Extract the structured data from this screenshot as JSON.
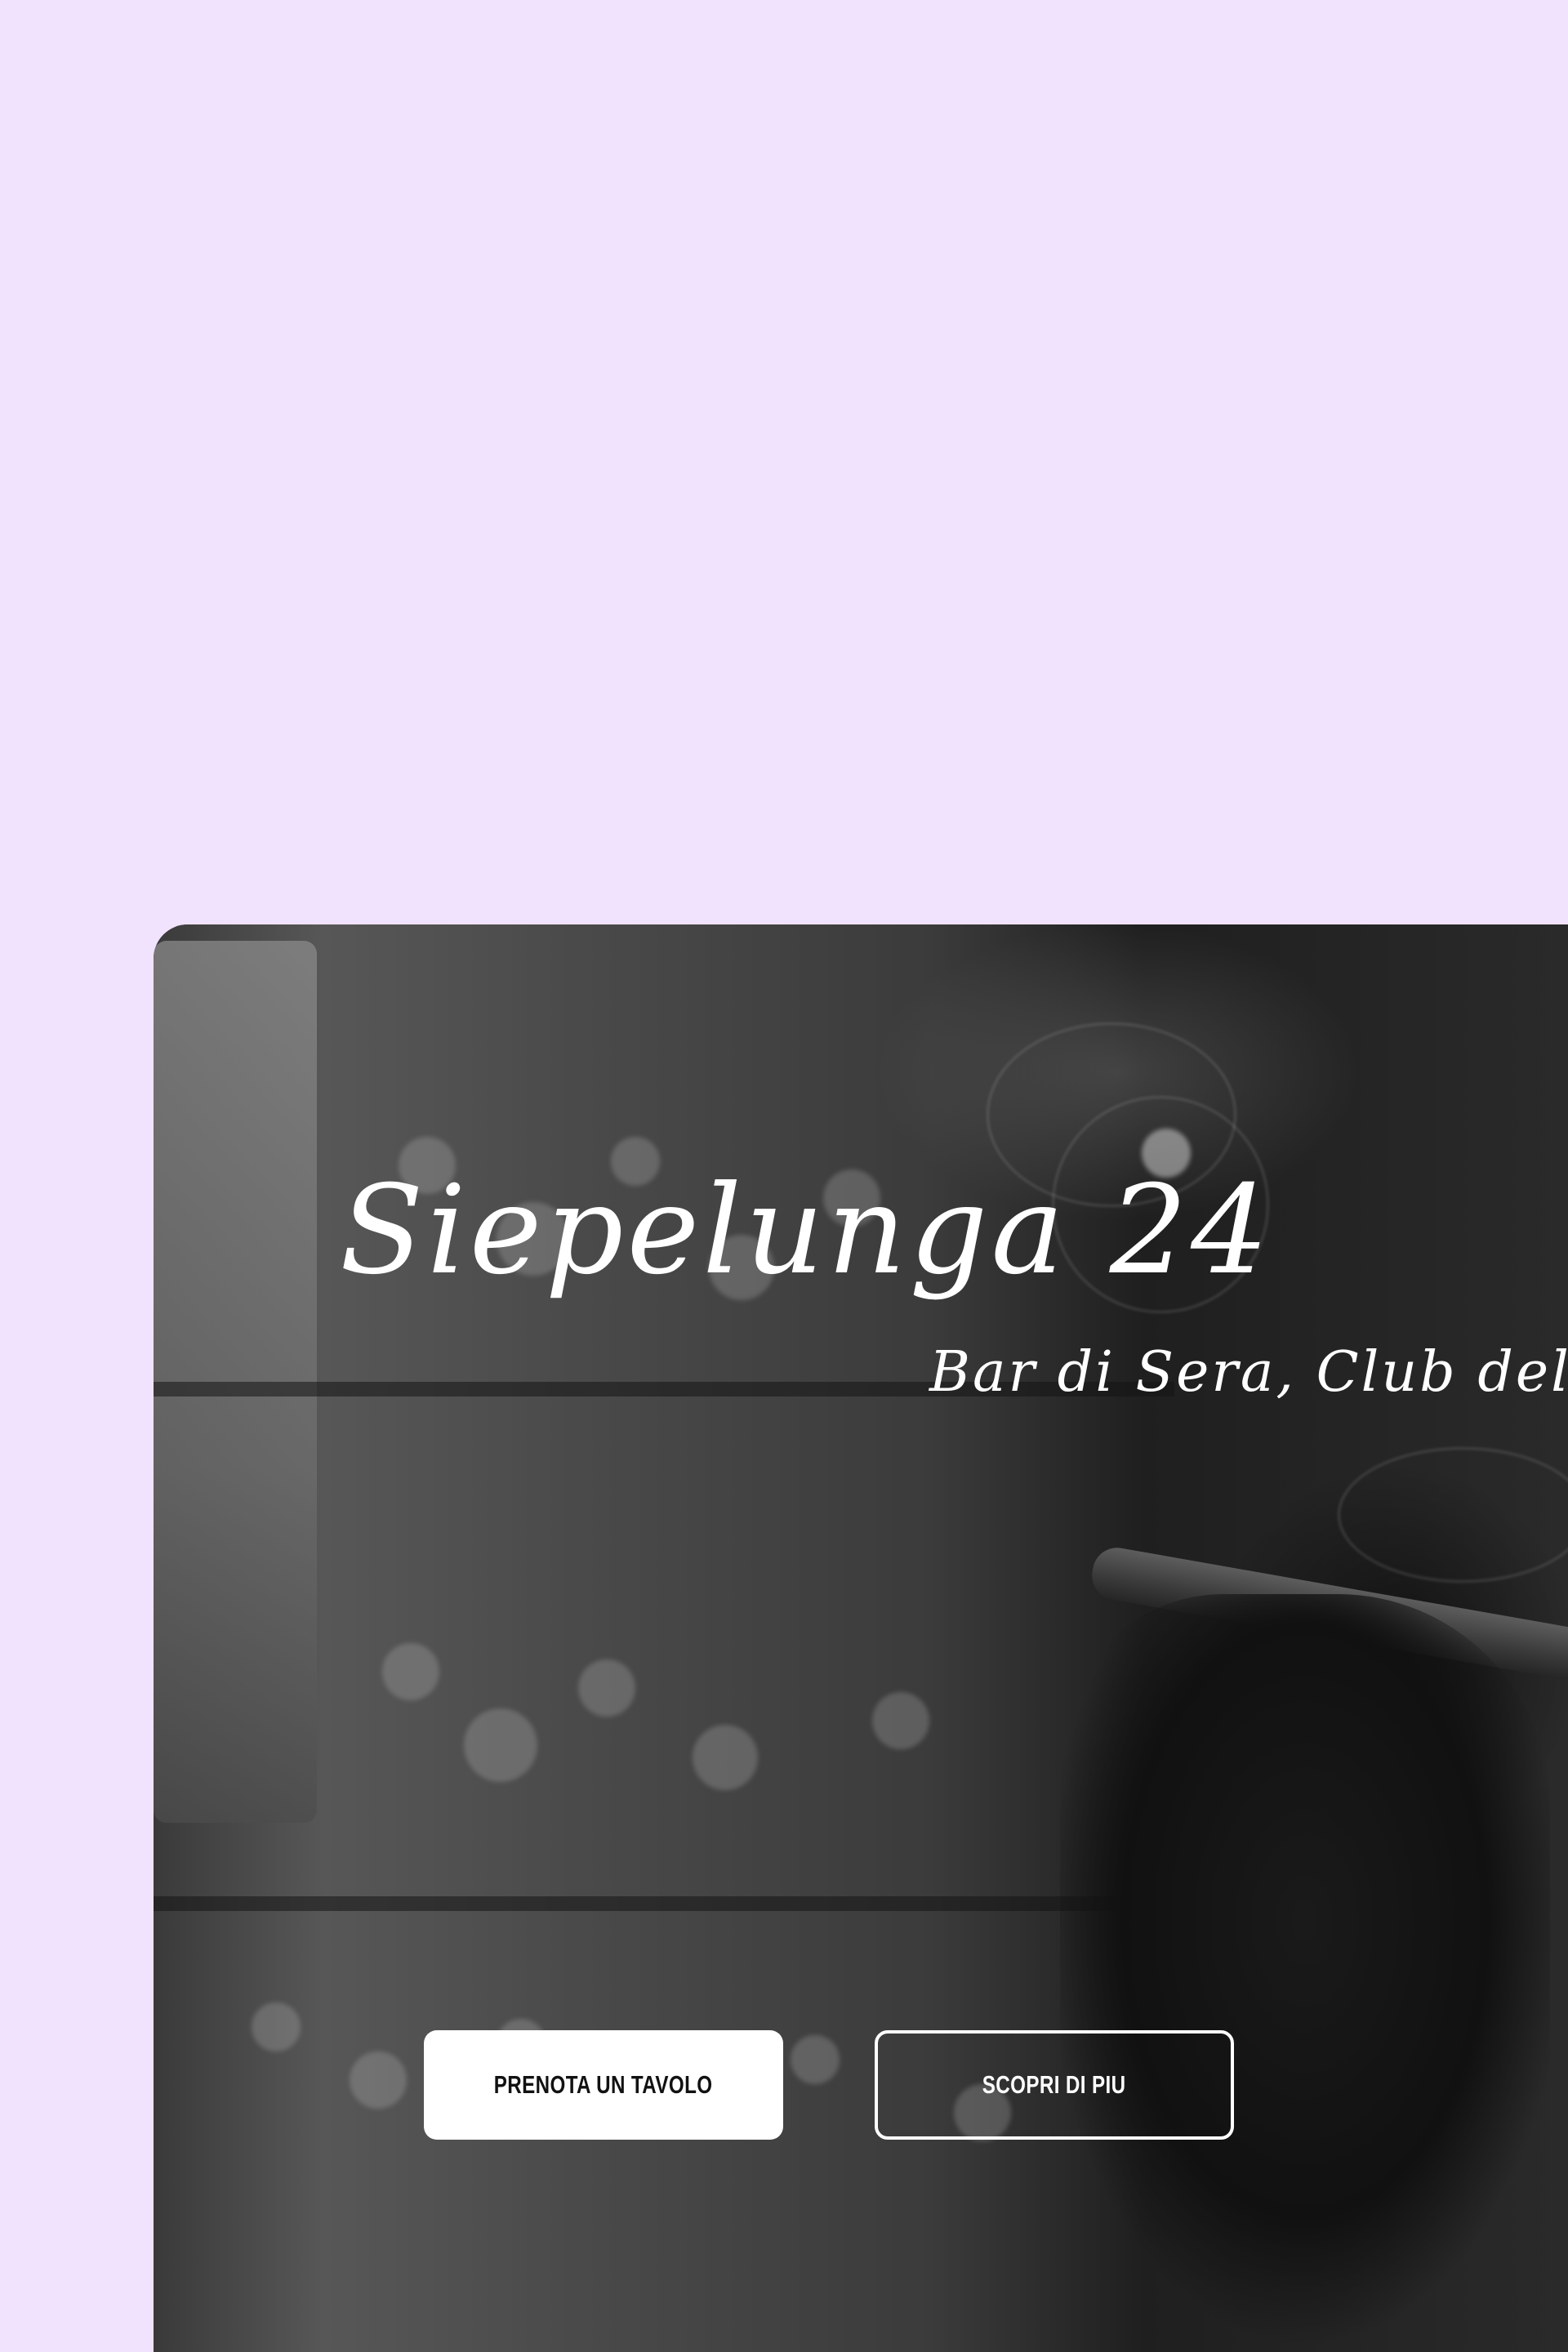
{
  "page": {
    "background_color": "#f1e2fe"
  },
  "hero": {
    "title": "Siepelunga 24",
    "subtitle": "Bar di Sera, Club del Sigaro",
    "primary_button_label": "PRENOTA UN TAVOLO",
    "secondary_button_label": "SCOPRI DI PIU",
    "image_description_icon": "bar-cigar-photo"
  }
}
